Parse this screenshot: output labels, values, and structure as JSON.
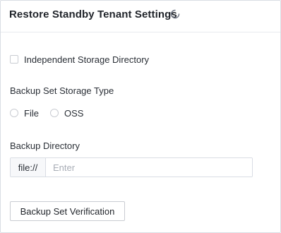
{
  "header": {
    "title": "Restore Standby Tenant Settings",
    "loading_icon": "loading-spinner-icon"
  },
  "independent_storage": {
    "label": "Independent Storage Directory",
    "checked": false
  },
  "storage_type": {
    "label": "Backup Set Storage Type",
    "options": [
      "File",
      "OSS"
    ],
    "selected": null
  },
  "backup_directory": {
    "label": "Backup Directory",
    "prefix": "file://",
    "value": "",
    "placeholder": "Enter"
  },
  "verify_button": {
    "label": "Backup Set Verification"
  },
  "colors": {
    "border": "#d9dde4",
    "text": "#1f2329",
    "placeholder": "#a8adb6",
    "addon_bg": "#f7f8fa"
  }
}
